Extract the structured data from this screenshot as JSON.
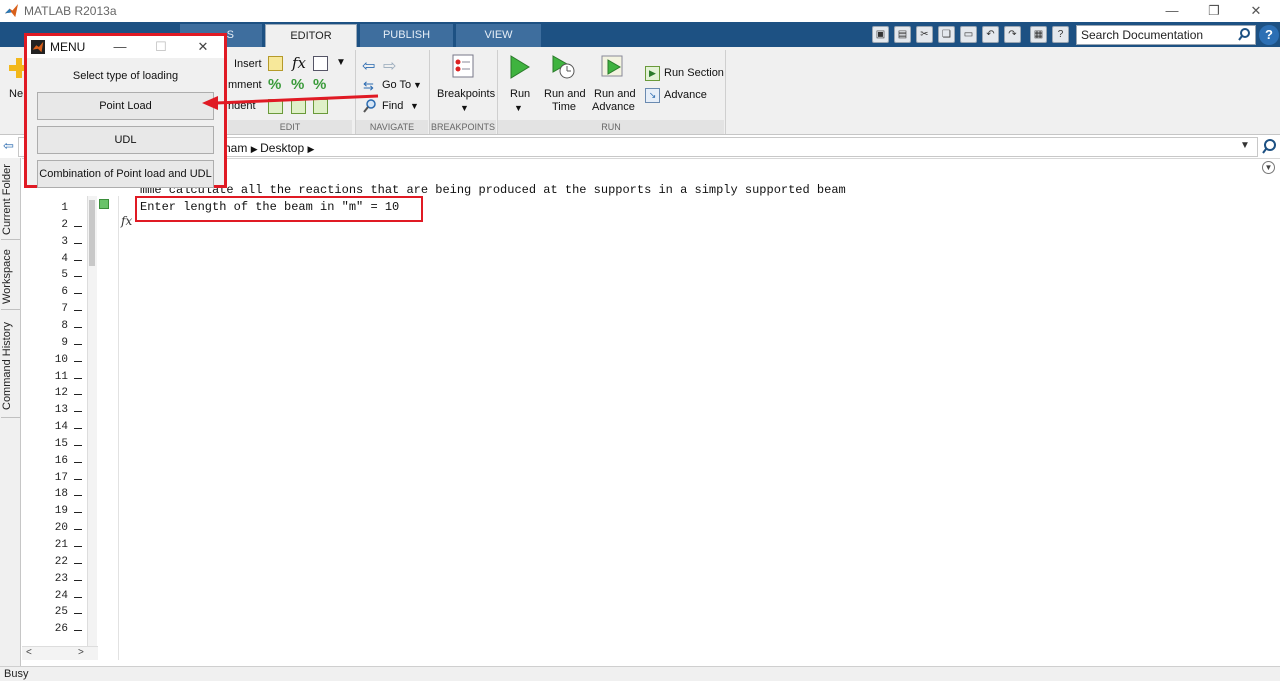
{
  "window": {
    "title": "MATLAB R2013a",
    "minimize": "—",
    "restore": "❐",
    "close": "✕"
  },
  "ribbon": {
    "tabs": [
      {
        "label": "S",
        "active": false
      },
      {
        "label": "EDITOR",
        "active": true
      },
      {
        "label": "PUBLISH",
        "active": false
      },
      {
        "label": "VIEW",
        "active": false
      }
    ],
    "new_label": "Ne",
    "edit": {
      "insert": "Insert",
      "comment": "mment",
      "indent": "ndent",
      "fx": "fx",
      "percent": "%",
      "group_label": "EDIT"
    },
    "navigate": {
      "goto": "Go To",
      "find": "Find",
      "group_label": "NAVIGATE"
    },
    "breakpoints": {
      "label": "Breakpoints",
      "group_label": "BREAKPOINTS"
    },
    "run": {
      "run": "Run",
      "run_and_time_1": "Run and",
      "run_and_time_2": "Time",
      "run_and_advance_1": "Run and",
      "run_and_advance_2": "Advance",
      "run_section": "Run Section",
      "advance": "Advance",
      "group_label": "RUN"
    }
  },
  "search": {
    "value": "Search Documentation"
  },
  "address": {
    "segment_1": "ham",
    "segment_2": "Desktop"
  },
  "side_tabs": {
    "current_folder": "Current Folder",
    "workspace": "Workspace",
    "command_history": "Command History"
  },
  "editor": {
    "line_numbers": [
      "1",
      "2",
      "3",
      "4",
      "5",
      "6",
      "7",
      "8",
      "9",
      "10",
      "11",
      "12",
      "13",
      "14",
      "15",
      "16",
      "17",
      "18",
      "19",
      "20",
      "21",
      "22",
      "23",
      "24",
      "25",
      "26"
    ],
    "line_1": "mme calculate all the reactions that are being produced at the supports in a simply supported beam",
    "line_2": "Enter length of the beam in \"m\" = 10",
    "fx": "fx"
  },
  "menu_dialog": {
    "title": "MENU",
    "minimize": "—",
    "maximize": "☐",
    "close": "✕",
    "prompt": "Select type of loading",
    "buttons": [
      "Point Load",
      "UDL",
      "Combination of Point load and UDL"
    ]
  },
  "status": {
    "text": "Busy"
  },
  "colors": {
    "tab_strip": "#1d5183",
    "annotation_red": "#e01a24"
  }
}
